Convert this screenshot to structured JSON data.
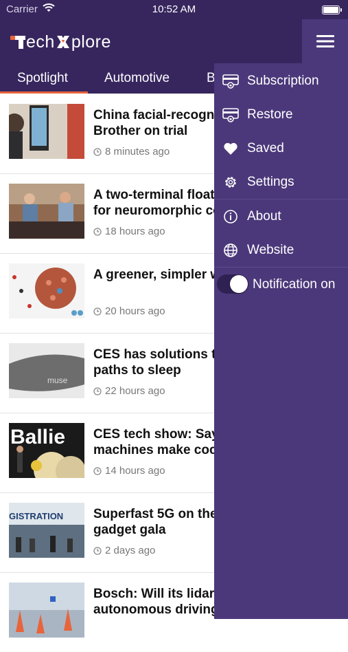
{
  "status_bar": {
    "carrier": "Carrier",
    "time": "10:52 AM"
  },
  "header": {
    "logo": {
      "part1": "ech",
      "part2": "plore"
    },
    "menu_icon": "hamburger-icon"
  },
  "tabs": [
    {
      "label": "Spotlight",
      "active": true
    },
    {
      "label": "Automotive",
      "active": false
    },
    {
      "label": "B",
      "active": false
    }
  ],
  "articles": [
    {
      "title": "China facial-recogniti… Brother on trial",
      "title_line1": "China facial-recogni",
      "title_line2": "Brother on trial",
      "time": "8 minutes ago"
    },
    {
      "title_line1": "A two-terminal floati",
      "title_line2": "for neuromorphic co",
      "time": "18 hours ago"
    },
    {
      "title_line1": "A greener, simpler w",
      "title_line2": "",
      "time": "20 hours ago"
    },
    {
      "title_line1": "CES has solutions to",
      "title_line2": "paths to sleep",
      "time": "22 hours ago",
      "thumb_text": "muse"
    },
    {
      "title_line1": "CES tech show: Say",
      "title_line2": "machines make coc",
      "time": "14 hours ago",
      "thumb_text": "Ballie"
    },
    {
      "title_line1": "Superfast 5G on the",
      "title_line2": "gadget gala",
      "time": "2 days ago",
      "thumb_text": "GISTRATION"
    },
    {
      "title_line1": "Bosch: Will its lidar t",
      "title_line2": "autonomous driving",
      "time": ""
    }
  ],
  "drawer": {
    "items": [
      {
        "label": "Subscription",
        "icon": "card-lock-icon"
      },
      {
        "label": "Restore",
        "icon": "card-lock-icon"
      },
      {
        "label": "Saved",
        "icon": "heart-icon"
      },
      {
        "label": "Settings",
        "icon": "gear-icon"
      },
      {
        "label": "About",
        "icon": "info-icon"
      },
      {
        "label": "Website",
        "icon": "globe-icon"
      }
    ],
    "notification": {
      "label": "Notification on",
      "enabled": true
    }
  },
  "colors": {
    "header_bg": "#37265e",
    "drawer_bg": "#4b387a",
    "accent": "#e8643c"
  }
}
